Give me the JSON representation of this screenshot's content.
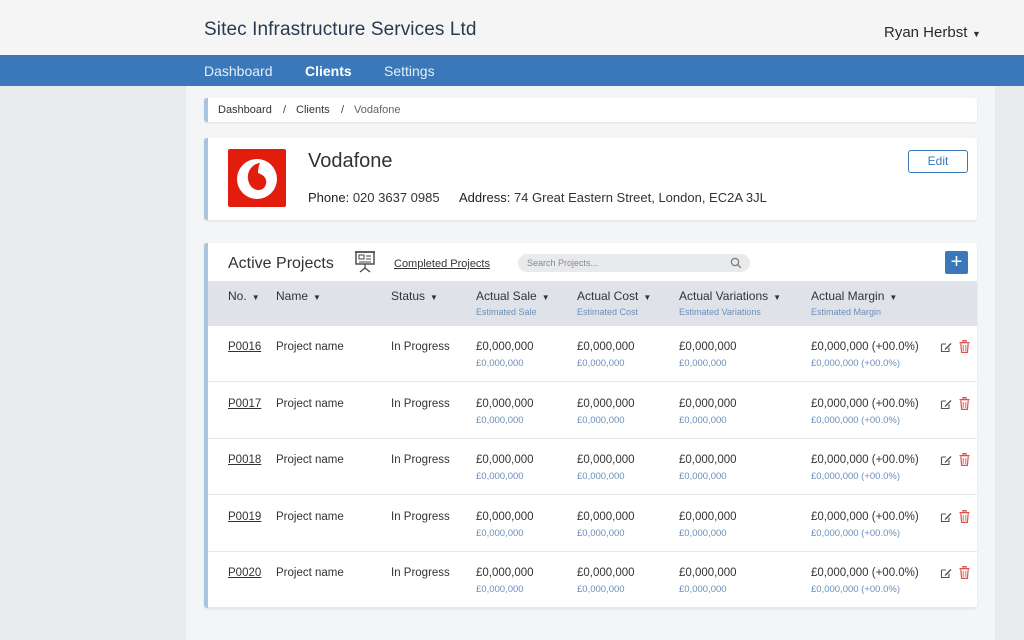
{
  "header": {
    "company": "Sitec Infrastructure Services Ltd",
    "user": "Ryan Herbst",
    "user_caret": "▼"
  },
  "nav": [
    {
      "label": "Dashboard"
    },
    {
      "label": "Clients"
    },
    {
      "label": "Settings"
    }
  ],
  "breadcrumb": {
    "items": [
      "Dashboard",
      "Clients",
      "Vodafone"
    ],
    "separator": "/"
  },
  "client": {
    "name": "Vodafone",
    "phone_label": "Phone:",
    "phone": "020 3637 0985",
    "address_label": "Address:",
    "address": "74 Great Eastern Street, London, EC2A 3JL",
    "edit_label": "Edit",
    "logo_color": "#e31d0e"
  },
  "projects": {
    "title": "Active Projects",
    "completed_link": "Completed Projects",
    "search_placeholder": "Search Projects...",
    "add_label": "+",
    "columns": [
      {
        "label": "No.",
        "sub": ""
      },
      {
        "label": "Name",
        "sub": ""
      },
      {
        "label": "Status",
        "sub": ""
      },
      {
        "label": "Actual Sale",
        "sub": "Estimated Sale"
      },
      {
        "label": "Actual Cost",
        "sub": "Estimated Cost"
      },
      {
        "label": "Actual Variations",
        "sub": "Estimated Variations"
      },
      {
        "label": "Actual Margin",
        "sub": "Estimated Margin"
      }
    ],
    "sort_caret": "▼",
    "rows": [
      {
        "no": "P0016",
        "name": "Project name",
        "status": "In Progress",
        "sale": "£0,000,000",
        "sale_est": "£0,000,000",
        "cost": "£0,000,000",
        "cost_est": "£0,000,000",
        "var": "£0,000,000",
        "var_est": "£0,000,000",
        "margin": "£0,000,000 (+00.0%)",
        "margin_est": "£0,000,000 (+00.0%)"
      },
      {
        "no": "P0017",
        "name": "Project name",
        "status": "In Progress",
        "sale": "£0,000,000",
        "sale_est": "£0,000,000",
        "cost": "£0,000,000",
        "cost_est": "£0,000,000",
        "var": "£0,000,000",
        "var_est": "£0,000,000",
        "margin": "£0,000,000 (+00.0%)",
        "margin_est": "£0,000,000 (+00.0%)"
      },
      {
        "no": "P0018",
        "name": "Project name",
        "status": "In Progress",
        "sale": "£0,000,000",
        "sale_est": "£0,000,000",
        "cost": "£0,000,000",
        "cost_est": "£0,000,000",
        "var": "£0,000,000",
        "var_est": "£0,000,000",
        "margin": "£0,000,000 (+00.0%)",
        "margin_est": "£0,000,000 (+00.0%)"
      },
      {
        "no": "P0019",
        "name": "Project name",
        "status": "In Progress",
        "sale": "£0,000,000",
        "sale_est": "£0,000,000",
        "cost": "£0,000,000",
        "cost_est": "£0,000,000",
        "var": "£0,000,000",
        "var_est": "£0,000,000",
        "margin": "£0,000,000 (+00.0%)",
        "margin_est": "£0,000,000 (+00.0%)"
      },
      {
        "no": "P0020",
        "name": "Project name",
        "status": "In Progress",
        "sale": "£0,000,000",
        "sale_est": "£0,000,000",
        "cost": "£0,000,000",
        "cost_est": "£0,000,000",
        "var": "£0,000,000",
        "var_est": "£0,000,000",
        "margin": "£0,000,000 (+00.0%)",
        "margin_est": "£0,000,000 (+00.0%)"
      }
    ]
  },
  "colors": {
    "nav_bg": "#3a78b9",
    "accent": "#3a78b9",
    "sub_text": "#6a8fb8",
    "delete": "#d9534f"
  }
}
